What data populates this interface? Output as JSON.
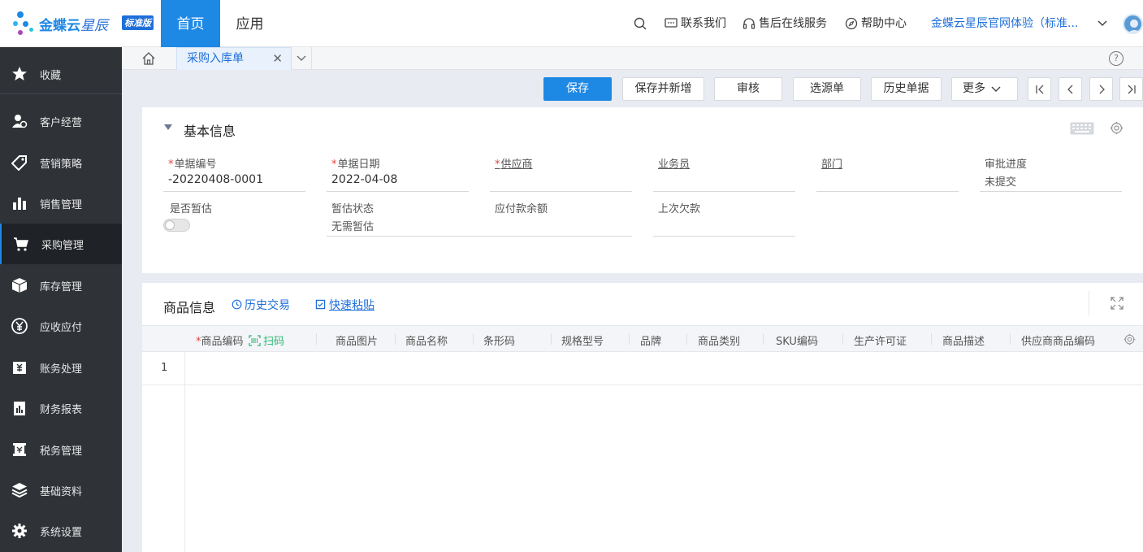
{
  "brand": {
    "name": "金蝶云",
    "sub": "星辰",
    "edition": "标准版"
  },
  "nav": {
    "home": "首页",
    "apps": "应用"
  },
  "top_links": {
    "contact": "联系我们",
    "support": "售后在线服务",
    "help": "帮助中心",
    "account": "金蝶云星辰官网体验（标准..."
  },
  "sidebar": {
    "items": [
      {
        "label": "收藏",
        "icon": "star-icon"
      },
      {
        "label": "客户经营",
        "icon": "customer-icon"
      },
      {
        "label": "营销策略",
        "icon": "tag-icon"
      },
      {
        "label": "销售管理",
        "icon": "bar-chart-icon"
      },
      {
        "label": "采购管理",
        "icon": "cart-icon"
      },
      {
        "label": "库存管理",
        "icon": "box-icon"
      },
      {
        "label": "应收应付",
        "icon": "coin-icon"
      },
      {
        "label": "账务处理",
        "icon": "ledger-icon"
      },
      {
        "label": "财务报表",
        "icon": "report-icon"
      },
      {
        "label": "税务管理",
        "icon": "tax-icon"
      },
      {
        "label": "基础资料",
        "icon": "layers-icon"
      },
      {
        "label": "系统设置",
        "icon": "gear-icon"
      }
    ],
    "active": "采购管理"
  },
  "tabs": {
    "current": "采购入库单"
  },
  "toolbar": {
    "save": "保存",
    "save_new": "保存并新增",
    "audit": "审核",
    "select_source": "选源单",
    "history_docs": "历史单据",
    "more": "更多"
  },
  "basic_info": {
    "title": "基本信息",
    "fields": {
      "doc_no": {
        "label": "单据编号",
        "value": "-20220408-0001",
        "required": true
      },
      "doc_date": {
        "label": "单据日期",
        "value": "2022-04-08",
        "required": true
      },
      "supplier": {
        "label": "供应商",
        "value": "",
        "required": true
      },
      "salesman": {
        "label": "业务员",
        "value": ""
      },
      "dept": {
        "label": "部门",
        "value": ""
      },
      "approval": {
        "label": "审批进度",
        "value": "未提交"
      },
      "estimate": {
        "label": "是否暂估",
        "value": false
      },
      "estimate_status": {
        "label": "暂估状态",
        "value": "无需暂估"
      },
      "payable_balance": {
        "label": "应付款余额",
        "value": ""
      },
      "last_debt": {
        "label": "上次欠款",
        "value": ""
      }
    }
  },
  "product_info": {
    "title": "商品信息",
    "history_trade": "历史交易",
    "quick_paste": "快速粘贴",
    "scan": "扫码",
    "columns": [
      "商品编码",
      "商品图片",
      "商品名称",
      "条形码",
      "规格型号",
      "品牌",
      "商品类别",
      "SKU编码",
      "生产许可证",
      "商品描述",
      "供应商商品编码"
    ],
    "rows": [
      {
        "num": "1"
      }
    ]
  },
  "colors": {
    "primary": "#1e88e5",
    "sidebar_bg": "#2f3338",
    "required": "#e0433b"
  }
}
